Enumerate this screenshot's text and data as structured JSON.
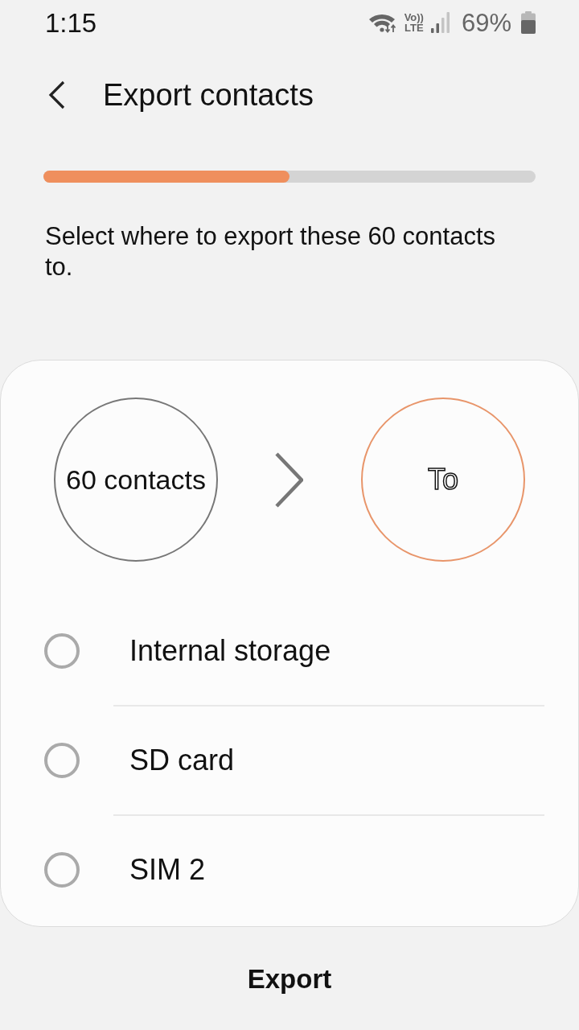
{
  "status_bar": {
    "time": "1:15",
    "volte_top": "Vo))",
    "volte_bottom": "LTE",
    "battery": "69%"
  },
  "header": {
    "title": "Export contacts"
  },
  "progress": {
    "level": 0.5
  },
  "description": "Select where to export these 60 contacts to.",
  "transfer": {
    "source": "60 contacts",
    "destination": "To"
  },
  "options": [
    {
      "label": "Internal storage",
      "selected": false
    },
    {
      "label": "SD card",
      "selected": false
    },
    {
      "label": "SIM 2",
      "selected": false
    }
  ],
  "actions": {
    "export": "Export"
  }
}
